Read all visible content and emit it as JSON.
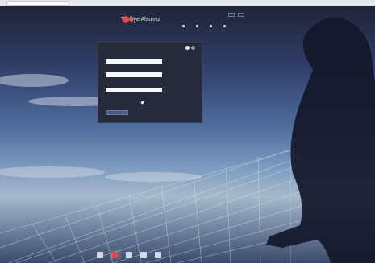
{
  "browser": {
    "url": ""
  },
  "brand": {
    "logo_text": "Türkiye Alsumu",
    "accent": "#e24b4b"
  },
  "topright": {
    "btn1": "",
    "btn2": ""
  },
  "topnav": [
    {
      "label": ""
    },
    {
      "label": ""
    },
    {
      "label": ""
    },
    {
      "label": ""
    }
  ],
  "login": {
    "username_label": "",
    "username_value": "",
    "password_label": "",
    "password_value": "",
    "third_label": "",
    "third_value": "",
    "forgot_text": "",
    "remember_label": "",
    "submit_label": ""
  },
  "bottombar": [
    {
      "label": "",
      "color": "#d6dae6"
    },
    {
      "label": "",
      "color": "#e24b4b"
    },
    {
      "label": "",
      "color": "#d6dae6"
    },
    {
      "label": "",
      "color": "#d6dae6"
    },
    {
      "label": "",
      "color": "#d6dae6"
    }
  ]
}
